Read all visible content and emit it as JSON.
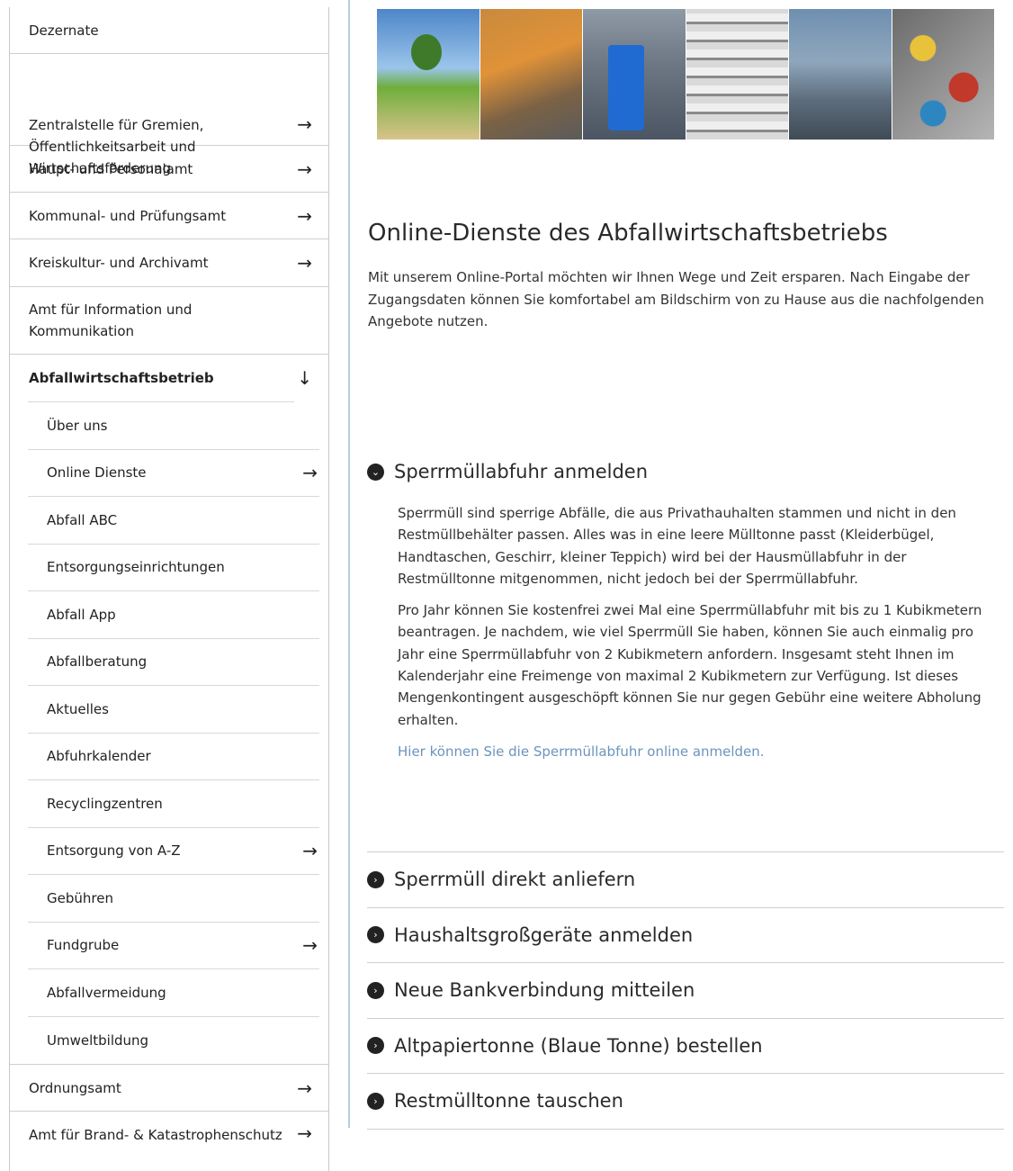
{
  "sidebar": {
    "items_top": [
      {
        "label": "Dezernate",
        "has_arrow": false
      },
      {
        "label": "Zentralstelle für Gremien, Öffentlichkeitsarbeit und Wirtschaftsförderung",
        "has_arrow": true
      },
      {
        "label": "Haupt- und Personalamt",
        "has_arrow": true
      },
      {
        "label": "Kommunal- und Prüfungsamt",
        "has_arrow": true
      },
      {
        "label": "Kreiskultur- und Archivamt",
        "has_arrow": true
      },
      {
        "label": "Amt für Information und Kommunikation",
        "has_arrow": false
      }
    ],
    "active": {
      "label": "Abfallwirtschaftsbetrieb",
      "arrow": "↓"
    },
    "sub_items": [
      {
        "label": "Über uns",
        "has_arrow": false
      },
      {
        "label": "Online Dienste",
        "has_arrow": true
      },
      {
        "label": "Abfall ABC",
        "has_arrow": false
      },
      {
        "label": "Entsorgungseinrichtungen",
        "has_arrow": false
      },
      {
        "label": "Abfall App",
        "has_arrow": false
      },
      {
        "label": "Abfallberatung",
        "has_arrow": false
      },
      {
        "label": "Aktuelles",
        "has_arrow": false
      },
      {
        "label": "Abfuhrkalender",
        "has_arrow": false
      },
      {
        "label": "Recyclingzentren",
        "has_arrow": false
      },
      {
        "label": "Entsorgung von A-Z",
        "has_arrow": true
      },
      {
        "label": "Gebühren",
        "has_arrow": false
      },
      {
        "label": "Fundgrube",
        "has_arrow": true
      },
      {
        "label": "Abfallvermeidung",
        "has_arrow": false
      },
      {
        "label": "Umweltbildung",
        "has_arrow": false
      }
    ],
    "items_bottom": [
      {
        "label": "Ordnungsamt",
        "has_arrow": true
      },
      {
        "label": "Amt für Brand- & Katastrophenschutz",
        "has_arrow": true
      }
    ],
    "arrow_glyph": "→"
  },
  "main": {
    "title": "Online-Dienste des Abfallwirtschaftsbetriebs",
    "intro": "Mit unserem Online-Portal möchten wir Ihnen Wege und Zeit ersparen. Nach Eingabe der Zugangsdaten können Sie komfortabel am Bildschirm von zu Hause aus die nachfolgenden Angebote nutzen.",
    "accordion_open": {
      "title": "Sperrmüllabfuhr anmelden",
      "icon": "chevron-down-circle-icon",
      "paragraph1": "Sperrmüll sind sperrige Abfälle, die aus Privathauhalten stammen und nicht in den Restmüllbehälter passen. Alles was in eine leere Mülltonne passt (Kleiderbügel, Handtaschen, Geschirr, kleiner Teppich) wird bei der Hausmüllabfuhr in der Restmülltonne mitgenommen, nicht jedoch bei der Sperrmüllabfuhr.",
      "paragraph2": "Pro Jahr können Sie kostenfrei zwei Mal eine Sperrmüllabfuhr mit bis zu 1 Kubikmetern beantragen. Je nachdem, wie viel Sperrmüll Sie haben, können Sie auch einmalig pro Jahr eine Sperrmüllabfuhr von 2 Kubikmetern anfordern. Insgesamt steht Ihnen im Kalenderjahr eine Freimenge von maximal 2 Kubikmetern zur Verfügung.  Ist dieses Mengenkontingent ausgeschöpft können Sie nur gegen Gebühr eine weitere Abholung erhalten.",
      "link": "Hier können Sie die Sperrmüllabfuhr online anmelden."
    },
    "accordion_closed": [
      {
        "title": "Sperrmüll direkt anliefern"
      },
      {
        "title": "Haushaltsgroßgeräte anmelden"
      },
      {
        "title": "Neue Bankverbindung mitteilen"
      },
      {
        "title": "Altpapiertonne (Blaue Tonne) bestellen"
      },
      {
        "title": "Restmülltonne tauschen"
      }
    ]
  },
  "colors": {
    "link": "#6b94bd",
    "divider": "#b8cbe0",
    "text": "#222222"
  }
}
